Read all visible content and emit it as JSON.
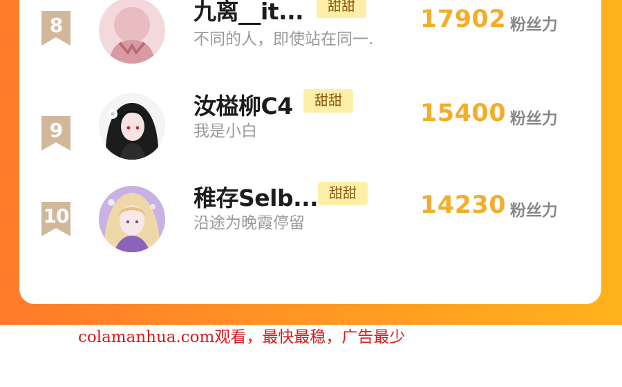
{
  "ranking": [
    {
      "rank": "8",
      "name": "九离__it...",
      "badge": "甜甜",
      "signature": "不同的人，即使站在同一.",
      "score": "17902",
      "unit": "粉丝力"
    },
    {
      "rank": "9",
      "name": "汝榏柳C4",
      "badge": "甜甜",
      "signature": "我是小白",
      "score": "15400",
      "unit": "粉丝力"
    },
    {
      "rank": "10",
      "name": "稚存Selb...",
      "badge": "甜甜",
      "signature": "沿途为晚霞停留",
      "score": "14230",
      "unit": "粉丝力"
    }
  ],
  "footer": {
    "text": "colamanhua.com观看，最快最稳，广告最少"
  },
  "colors": {
    "gradient_start": "#ff7a2a",
    "gradient_end": "#ffb21c",
    "score": "#f2ad2a",
    "badge_bg": "#fdefa8",
    "rank_tag": "#d2b89a",
    "footer": "#d81a1a"
  }
}
